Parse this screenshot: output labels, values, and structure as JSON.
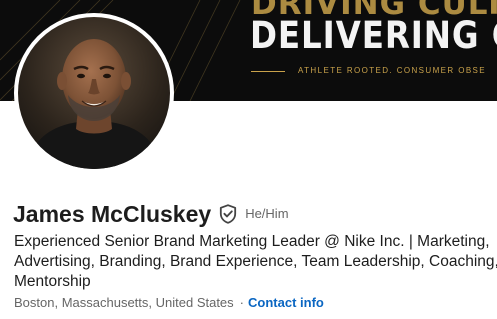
{
  "banner": {
    "line1": "DRIVING CULTURE",
    "line2": "DELIVERING GRO",
    "tagline": "ATHLETE ROOTED. CONSUMER OBSE",
    "accent_color": "#c9a24b",
    "background_color": "#0c0c0c"
  },
  "profile": {
    "name": "James McCluskey",
    "verified_icon": "shield-check-icon",
    "pronouns": "He/Him",
    "headline_lines": [
      "Experienced Senior Brand Marketing Leader @ Nike Inc. | Marketing,",
      "Advertising, Branding, Brand Experience, Team Leadership, Coaching,",
      "Mentorship"
    ],
    "location": "Boston, Massachusetts, United States",
    "separator": "·",
    "contact_label": "Contact info",
    "link_color": "#0a66c2"
  }
}
